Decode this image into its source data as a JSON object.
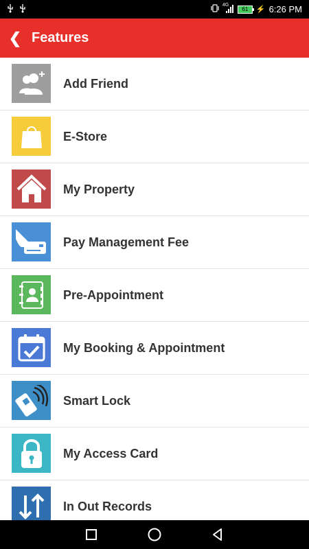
{
  "status_bar": {
    "left_icons": [
      "usb-icon",
      "usb-icon"
    ],
    "network": "4G",
    "battery_level": "61",
    "time": "6:26 PM"
  },
  "app_bar": {
    "back_glyph": "❮",
    "title": "Features",
    "color": "#e8302a"
  },
  "features": [
    {
      "label": "Add Friend",
      "icon": "add-friend-icon",
      "color": "#9e9e9e"
    },
    {
      "label": "E-Store",
      "icon": "shopping-bag-icon",
      "color": "#f6cc3b"
    },
    {
      "label": "My Property",
      "icon": "house-icon",
      "color": "#c04a4a"
    },
    {
      "label": "Pay Management Fee",
      "icon": "card-payment-icon",
      "color": "#4a90d6"
    },
    {
      "label": "Pre-Appointment",
      "icon": "address-book-icon",
      "color": "#5cb85c"
    },
    {
      "label": "My Booking & Appointment",
      "icon": "calendar-check-icon",
      "color": "#4a7ad6"
    },
    {
      "label": "Smart Lock",
      "icon": "nfc-phone-icon",
      "color": "#3e8fc7"
    },
    {
      "label": "My Access Card",
      "icon": "padlock-icon",
      "color": "#3ab6c4"
    },
    {
      "label": "In Out Records",
      "icon": "in-out-arrows-icon",
      "color": "#2f6fb0"
    }
  ],
  "nav_bar": {
    "buttons": [
      "recents-square-icon",
      "home-circle-icon",
      "back-triangle-icon"
    ]
  }
}
